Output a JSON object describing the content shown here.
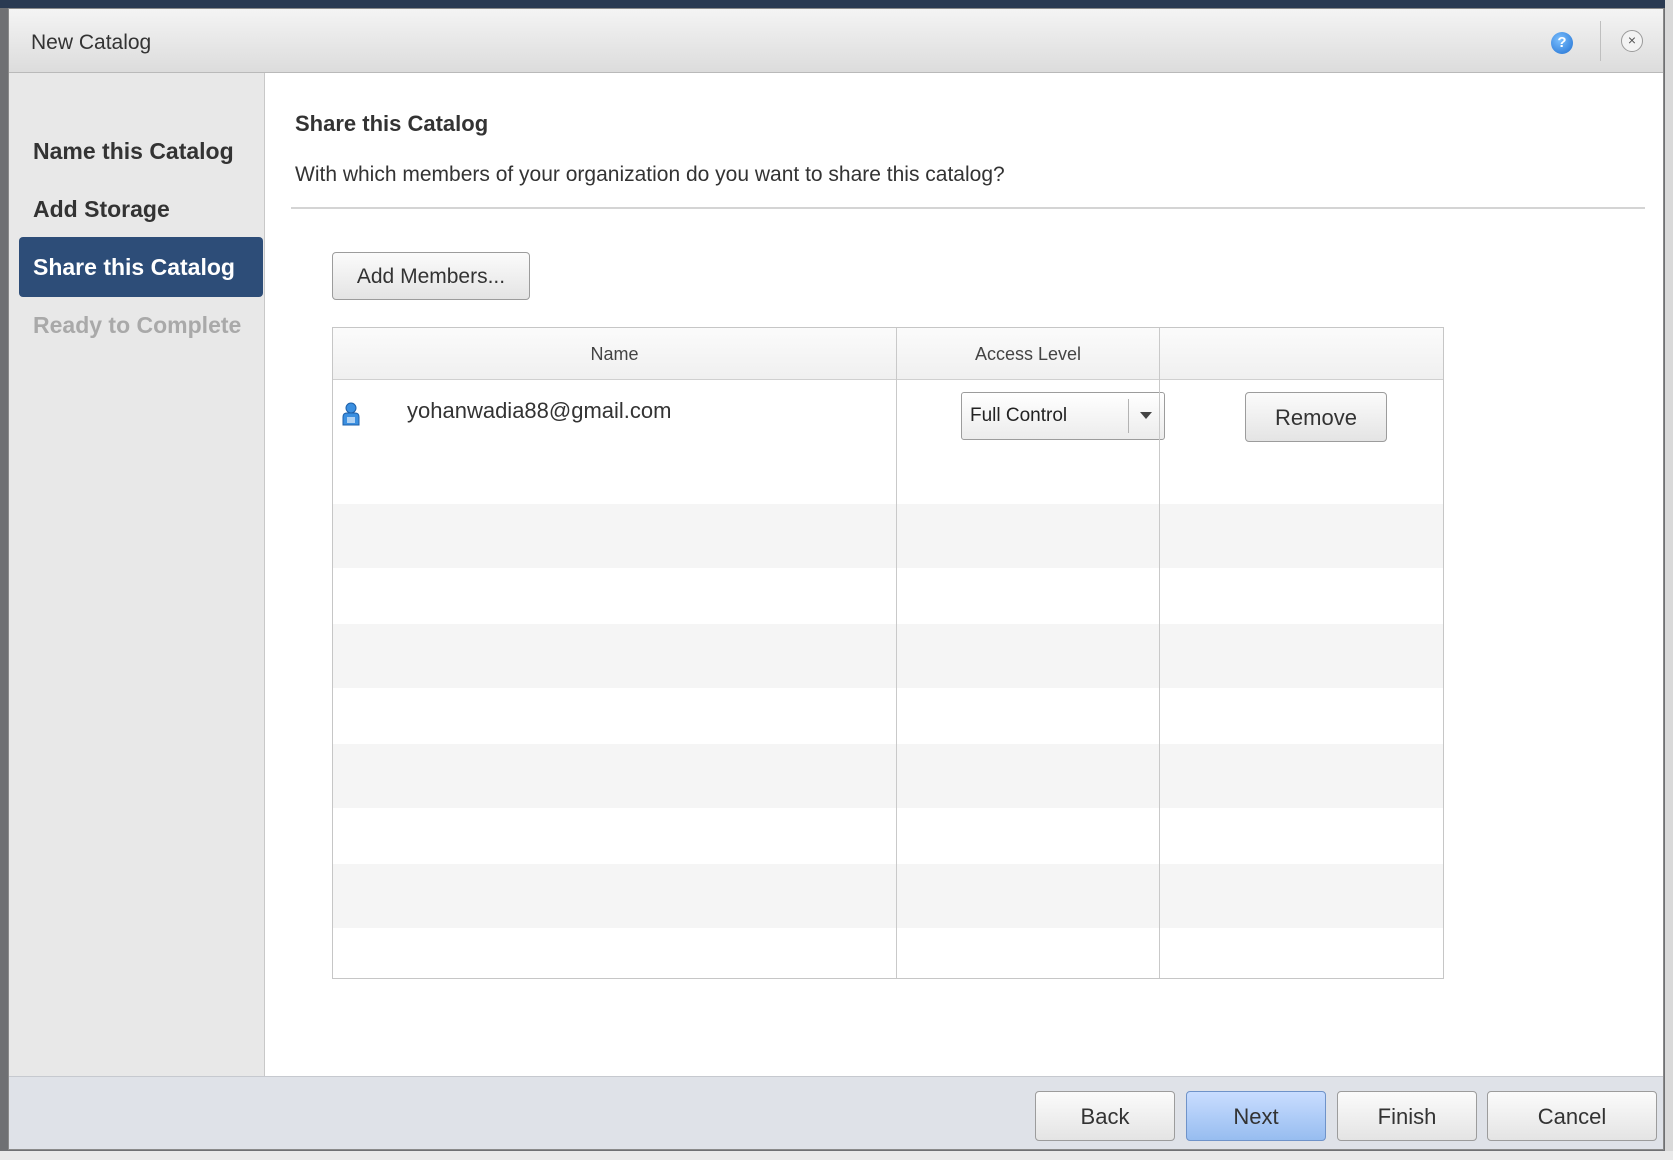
{
  "dialog": {
    "title": "New Catalog"
  },
  "icons": {
    "help": "?",
    "close": "×"
  },
  "sidebar": {
    "items": [
      {
        "label": "Name this Catalog",
        "state": "done"
      },
      {
        "label": "Add Storage",
        "state": "done"
      },
      {
        "label": "Share this Catalog",
        "state": "active"
      },
      {
        "label": "Ready to Complete",
        "state": "disabled"
      }
    ]
  },
  "main": {
    "heading": "Share this Catalog",
    "question": "With which members of your organization do you want to share this catalog?",
    "add_members_label": "Add Members...",
    "table": {
      "columns": [
        "Name",
        "Access Level",
        ""
      ],
      "rows": [
        {
          "name": "yohanwadia88@gmail.com",
          "access_level": "Full Control",
          "action": "Remove"
        }
      ]
    }
  },
  "footer": {
    "back": "Back",
    "next": "Next",
    "finish": "Finish",
    "cancel": "Cancel"
  },
  "colors": {
    "active_step_bg": "#2d4d78",
    "next_button_bg": "#a9c8f5"
  }
}
